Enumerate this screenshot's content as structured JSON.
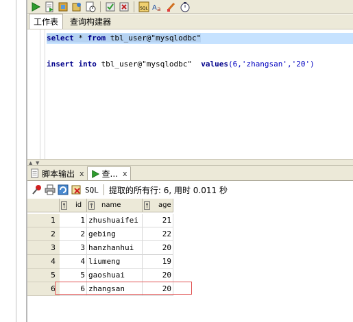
{
  "toolbar": {
    "icons": [
      "run-icon",
      "run-script-icon",
      "explain-plan-icon",
      "autotrace-icon",
      "sql-history-icon",
      "commit-icon",
      "rollback-icon",
      "sql-format-icon",
      "find-replace-icon",
      "clear-icon",
      "timer-icon"
    ]
  },
  "editor_tabs": [
    {
      "label": "工作表",
      "active": true
    },
    {
      "label": "查询构建器",
      "active": false
    }
  ],
  "editor": {
    "line1": {
      "kw1": "select",
      "mid": " * ",
      "kw2": "from",
      "rest": " tbl_user@\"mysqlodbc\""
    },
    "line3": {
      "kw1": "insert",
      "sp1": " ",
      "kw2": "into",
      "rest": " tbl_user@\"mysqlodbc\"  ",
      "kw3": "values",
      "vals": "(6,'zhangsan','20')"
    }
  },
  "result_tabs": [
    {
      "label": "脚本输出",
      "close": "x",
      "active": false
    },
    {
      "label": "查...",
      "close": "x",
      "active": true
    }
  ],
  "result_toolbar": {
    "sql_label": "SQL",
    "message": "提取的所有行: 6, 用时 0.011 秒"
  },
  "grid": {
    "columns": [
      "id",
      "name",
      "age"
    ],
    "rows": [
      {
        "n": "1",
        "id": "1",
        "name": "zhushuaifei",
        "age": "21"
      },
      {
        "n": "2",
        "id": "2",
        "name": "gebing",
        "age": "22"
      },
      {
        "n": "3",
        "id": "3",
        "name": "hanzhanhui",
        "age": "20"
      },
      {
        "n": "4",
        "id": "4",
        "name": "liumeng",
        "age": "19"
      },
      {
        "n": "5",
        "id": "5",
        "name": "gaoshuai",
        "age": "20"
      },
      {
        "n": "6",
        "id": "6",
        "name": "zhangsan",
        "age": "20"
      }
    ]
  },
  "colors": {
    "highlight_row_border": "#e05050",
    "selection": "#c6e2ff",
    "keyword": "#00008b"
  }
}
